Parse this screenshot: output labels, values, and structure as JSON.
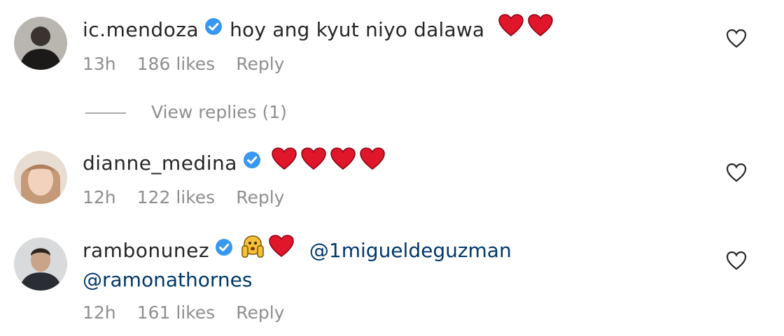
{
  "comments": [
    {
      "username": "ic.mendoza",
      "text": "hoy ang kyut niyo dalawa",
      "hearts": 2,
      "time": "13h",
      "likes": "186 likes",
      "reply": "Reply"
    },
    {
      "username": "dianne_medina",
      "text": "",
      "hearts": 4,
      "time": "12h",
      "likes": "122 likes",
      "reply": "Reply"
    },
    {
      "username": "rambonunez",
      "mention1": "@1migueldeguzman",
      "mention2": "@ramonathornes",
      "hearts": 1,
      "time": "12h",
      "likes": "161 likes",
      "reply": "Reply"
    }
  ],
  "view_replies": "View replies (1)",
  "colors": {
    "heart": "#e0162b",
    "verified": "#3897f0",
    "meta": "#8e8e8e",
    "mention": "#00376b"
  }
}
